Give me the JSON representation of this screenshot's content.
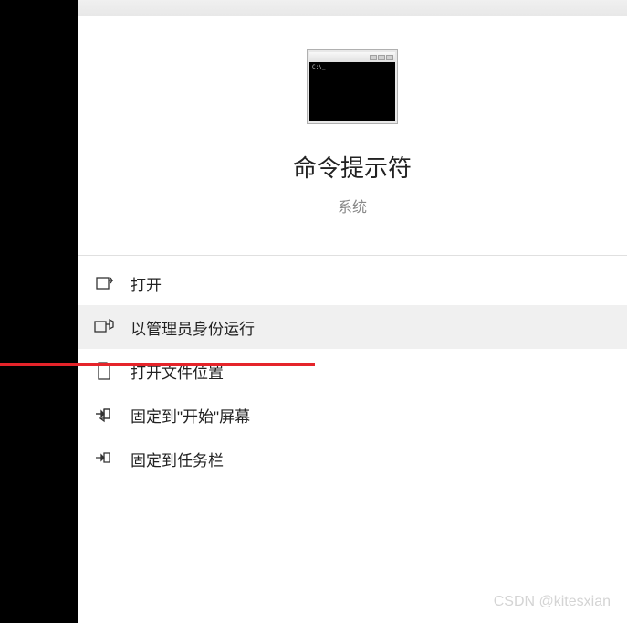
{
  "app": {
    "title": "命令提示符",
    "subtitle": "系统",
    "thumb_prompt": "C:\\_"
  },
  "menu": {
    "items": [
      {
        "label": "打开",
        "icon": "open-icon",
        "highlight": false
      },
      {
        "label": "以管理员身份运行",
        "icon": "run-admin-icon",
        "highlight": true
      },
      {
        "label": "打开文件位置",
        "icon": "file-location-icon",
        "highlight": false
      },
      {
        "label": "固定到\"开始\"屏幕",
        "icon": "pin-start-icon",
        "highlight": false
      },
      {
        "label": "固定到任务栏",
        "icon": "pin-taskbar-icon",
        "highlight": false
      }
    ]
  },
  "watermark": "CSDN @kitesxian"
}
